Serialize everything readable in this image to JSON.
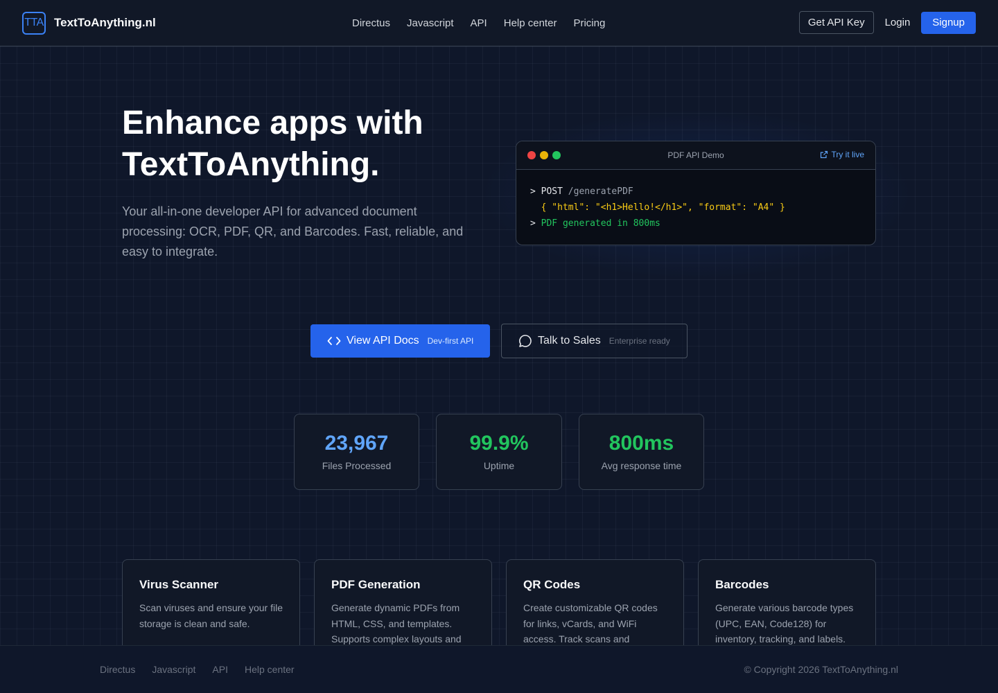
{
  "header": {
    "logo_text": "TTA",
    "brand_name": "TextToAnything.nl",
    "nav": [
      "Directus",
      "Javascript",
      "API",
      "Help center",
      "Pricing"
    ],
    "get_api_key": "Get API Key",
    "login": "Login",
    "signup": "Signup"
  },
  "hero": {
    "title_line1": "Enhance apps with",
    "title_line2": "TextToAnything.",
    "subtitle": "Your all-in-one developer API for advanced document processing: OCR, PDF, QR, and Barcodes. Fast, reliable, and easy to integrate."
  },
  "terminal": {
    "title": "PDF API Demo",
    "try_live": "Try it live",
    "prompt": ">",
    "method": "POST",
    "endpoint": "/generatePDF",
    "payload": "{ \"html\": \"<h1>Hello!</h1>\", \"format\": \"A4\" }",
    "result": "PDF generated in 800ms",
    "dot_colors": [
      "#ef4444",
      "#eab308",
      "#22c55e"
    ]
  },
  "cta": {
    "primary_label": "View API Docs",
    "primary_tag": "Dev-first API",
    "secondary_label": "Talk to Sales",
    "secondary_tag": "Enterprise ready"
  },
  "stats": [
    {
      "value": "23,967",
      "label": "Files Processed",
      "color": "#60a5fa"
    },
    {
      "value": "99.9%",
      "label": "Uptime",
      "color": "#22c55e"
    },
    {
      "value": "800ms",
      "label": "Avg response time",
      "color": "#22c55e"
    }
  ],
  "features": [
    {
      "title": "Virus Scanner",
      "desc": "Scan viruses and ensure your file storage is clean and safe."
    },
    {
      "title": "PDF Generation",
      "desc": "Generate dynamic PDFs from HTML, CSS, and templates. Supports complex layouts and"
    },
    {
      "title": "QR Codes",
      "desc": "Create customizable QR codes for links, vCards, and WiFi access. Track scans and"
    },
    {
      "title": "Barcodes",
      "desc": "Generate various barcode types (UPC, EAN, Code128) for inventory, tracking, and labels."
    }
  ],
  "footer": {
    "links": [
      "Directus",
      "Javascript",
      "API",
      "Help center"
    ],
    "copyright": "© Copyright 2026 TextToAnything.nl"
  },
  "colors": {
    "accent": "#2563eb",
    "background": "#0f172a"
  }
}
